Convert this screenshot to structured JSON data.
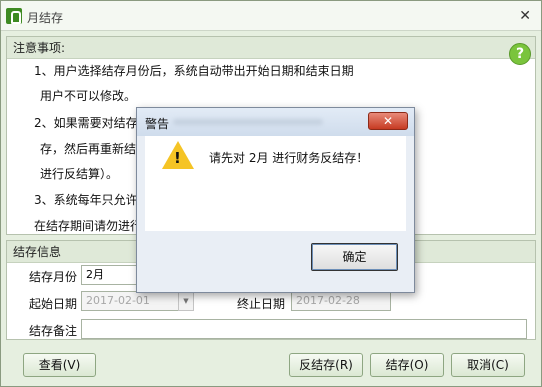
{
  "window": {
    "title": "月结存",
    "close_glyph": "✕"
  },
  "notice": {
    "header": "注意事项:",
    "help_glyph": "?",
    "lines": [
      "1、用户选择结存月份后，系统自动带出开始日期和结束日期",
      "用户不可以修改。",
      "2、如果需要对结存",
      "存，然后再重新结",
      "进行反结算）。",
      "3、系统每年只允许",
      "在结存期间请勿进行"
    ]
  },
  "form": {
    "header": "结存信息",
    "month_label": "结存月份",
    "month_value": "2月",
    "start_label": "起始日期",
    "start_value": "2017-02-01",
    "end_label": "终止日期",
    "end_value": "2017-02-28",
    "note_label": "结存备注",
    "note_value": ""
  },
  "buttons": {
    "view": "查看(V)",
    "reverse": "反结存(R)",
    "close_month": "结存(O)",
    "cancel": "取消(C)"
  },
  "dialog": {
    "title": "警告",
    "close_glyph": "✕",
    "message": "请先对 2月 进行财务反结存！",
    "ok_label": "确定",
    "icon": "warning-icon"
  }
}
